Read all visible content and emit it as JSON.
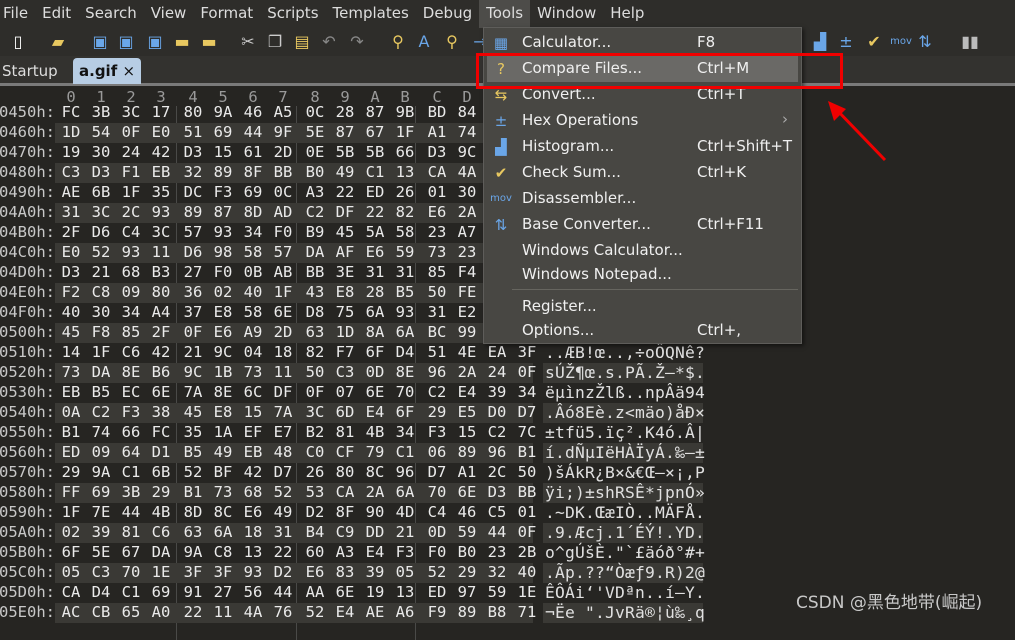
{
  "menubar": [
    "File",
    "Edit",
    "Search",
    "View",
    "Format",
    "Scripts",
    "Templates",
    "Debug",
    "Tools",
    "Window",
    "Help"
  ],
  "active_menu": "Tools",
  "toolbar": [
    {
      "icon": "new-file-icon",
      "glyph": "▯",
      "color": "#ffffff"
    },
    {
      "icon": "open-folder-icon",
      "glyph": "▰",
      "color": "#e8c860"
    },
    {
      "icon": "save-icon",
      "glyph": "▣",
      "color": "#6aa6e8"
    },
    {
      "icon": "save-as-icon",
      "glyph": "▣",
      "color": "#6aa6e8"
    },
    {
      "icon": "save-all-icon",
      "glyph": "▣",
      "color": "#6aa6e8"
    },
    {
      "icon": "folder-icon",
      "glyph": "▬",
      "color": "#e8c860"
    },
    {
      "icon": "folders-icon",
      "glyph": "▬",
      "color": "#e8c860"
    },
    {
      "icon": "cut-icon",
      "glyph": "✂",
      "color": "#cccccc"
    },
    {
      "icon": "copy-icon",
      "glyph": "❐",
      "color": "#cccccc"
    },
    {
      "icon": "paste-icon",
      "glyph": "▤",
      "color": "#e8c860"
    },
    {
      "icon": "undo-icon",
      "glyph": "↶",
      "color": "#888888"
    },
    {
      "icon": "redo-icon",
      "glyph": "↷",
      "color": "#888888"
    },
    {
      "icon": "find-icon",
      "glyph": "⚲",
      "color": "#e8c860"
    },
    {
      "icon": "replace-icon",
      "glyph": "A",
      "color": "#6aa6e8"
    },
    {
      "icon": "find-in-files-icon",
      "glyph": "⚲",
      "color": "#e8c860"
    },
    {
      "icon": "goto-icon",
      "glyph": "→",
      "color": "#6aa6e8"
    },
    {
      "icon": "histogram-icon",
      "glyph": "▟",
      "color": "#6aa6e8"
    },
    {
      "icon": "hex-operations-icon",
      "glyph": "±",
      "color": "#6aa6e8"
    },
    {
      "icon": "checksum-icon",
      "glyph": "✔",
      "color": "#e8c860"
    },
    {
      "icon": "disassembler-icon",
      "glyph": "mov",
      "color": "#6aa6e8"
    },
    {
      "icon": "base-converter-icon",
      "glyph": "⇅",
      "color": "#6aa6e8"
    },
    {
      "icon": "pause-icon",
      "glyph": "▮▮",
      "color": "#bbbbbb"
    }
  ],
  "tabs": [
    {
      "label": "Startup"
    },
    {
      "label": "a.gif",
      "close": "×"
    }
  ],
  "column_headers": [
    "0",
    "1",
    "2",
    "3",
    "4",
    "5",
    "6",
    "7",
    "8",
    "9",
    "A",
    "B",
    "C",
    "D"
  ],
  "rows": [
    {
      "addr": "0450h:",
      "bytes": [
        "FC",
        "3B",
        "3C",
        "17",
        "80",
        "9A",
        "46",
        "A5",
        "0C",
        "28",
        "87",
        "9B",
        "BD",
        "84"
      ],
      "ascii": ""
    },
    {
      "addr": "0460h:",
      "bytes": [
        "1D",
        "54",
        "0F",
        "E0",
        "51",
        "69",
        "44",
        "9F",
        "5E",
        "87",
        "67",
        "1F",
        "A1",
        "74"
      ],
      "ascii": ""
    },
    {
      "addr": "0470h:",
      "bytes": [
        "19",
        "30",
        "24",
        "42",
        "D3",
        "15",
        "61",
        "2D",
        "0E",
        "5B",
        "5B",
        "66",
        "D3",
        "9C"
      ],
      "ascii": ""
    },
    {
      "addr": "0480h:",
      "bytes": [
        "C3",
        "D3",
        "F1",
        "EB",
        "32",
        "89",
        "8F",
        "BB",
        "B0",
        "49",
        "C1",
        "13",
        "CA",
        "4A"
      ],
      "ascii": ""
    },
    {
      "addr": "0490h:",
      "bytes": [
        "AE",
        "6B",
        "1F",
        "35",
        "DC",
        "F3",
        "69",
        "0C",
        "A3",
        "22",
        "ED",
        "26",
        "01",
        "30"
      ],
      "ascii": ""
    },
    {
      "addr": "04A0h:",
      "bytes": [
        "31",
        "3C",
        "2C",
        "93",
        "89",
        "87",
        "8D",
        "AD",
        "C2",
        "DF",
        "22",
        "82",
        "E6",
        "2A"
      ],
      "ascii": ""
    },
    {
      "addr": "04B0h:",
      "bytes": [
        "2F",
        "D6",
        "C4",
        "3C",
        "57",
        "93",
        "34",
        "F0",
        "B9",
        "45",
        "5A",
        "58",
        "23",
        "A7"
      ],
      "ascii": ""
    },
    {
      "addr": "04C0h:",
      "bytes": [
        "E0",
        "52",
        "93",
        "11",
        "D6",
        "98",
        "58",
        "57",
        "DA",
        "AF",
        "E6",
        "59",
        "73",
        "23"
      ],
      "ascii": ""
    },
    {
      "addr": "04D0h:",
      "bytes": [
        "D3",
        "21",
        "68",
        "B3",
        "27",
        "F0",
        "0B",
        "AB",
        "BB",
        "3E",
        "31",
        "31",
        "85",
        "F4"
      ],
      "ascii": ""
    },
    {
      "addr": "04E0h:",
      "bytes": [
        "F2",
        "C8",
        "09",
        "80",
        "36",
        "02",
        "40",
        "1F",
        "43",
        "E8",
        "28",
        "B5",
        "50",
        "FE"
      ],
      "ascii": ""
    },
    {
      "addr": "04F0h:",
      "bytes": [
        "40",
        "30",
        "34",
        "A4",
        "37",
        "E8",
        "58",
        "6E",
        "D8",
        "75",
        "6A",
        "93",
        "31",
        "E2"
      ],
      "ascii": ""
    },
    {
      "addr": "0500h:",
      "bytes": [
        "45",
        "F8",
        "85",
        "2F",
        "0F",
        "E6",
        "A9",
        "2D",
        "63",
        "1D",
        "8A",
        "6A",
        "BC",
        "99"
      ],
      "ascii": ""
    },
    {
      "addr": "0510h:",
      "bytes": [
        "14",
        "1F",
        "C6",
        "42",
        "21",
        "9C",
        "04",
        "18",
        "82",
        "F7",
        "6F",
        "D4",
        "51",
        "4E",
        "EA",
        "3F"
      ],
      "ascii": "..ÆB!œ..‚÷oÔQNê?"
    },
    {
      "addr": "0520h:",
      "bytes": [
        "73",
        "DA",
        "8E",
        "B6",
        "9C",
        "1B",
        "73",
        "11",
        "50",
        "C3",
        "0D",
        "8E",
        "96",
        "2A",
        "24",
        "0F"
      ],
      "ascii": "sÚŽ¶œ.s.PÃ.Ž–*$."
    },
    {
      "addr": "0530h:",
      "bytes": [
        "EB",
        "B5",
        "EC",
        "6E",
        "7A",
        "8E",
        "6C",
        "DF",
        "0F",
        "07",
        "6E",
        "70",
        "C2",
        "E4",
        "39",
        "34"
      ],
      "ascii": "ëµìnzŽlß..npÂä94"
    },
    {
      "addr": "0540h:",
      "bytes": [
        "0A",
        "C2",
        "F3",
        "38",
        "45",
        "E8",
        "15",
        "7A",
        "3C",
        "6D",
        "E4",
        "6F",
        "29",
        "E5",
        "D0",
        "D7"
      ],
      "ascii": ".Âó8Eè.z<mäo)åÐ×"
    },
    {
      "addr": "0550h:",
      "bytes": [
        "B1",
        "74",
        "66",
        "FC",
        "35",
        "1A",
        "EF",
        "E7",
        "B2",
        "81",
        "4B",
        "34",
        "F3",
        "15",
        "C2",
        "7C"
      ],
      "ascii": "±tfü5.ïç².K4ó.Â|"
    },
    {
      "addr": "0560h:",
      "bytes": [
        "ED",
        "09",
        "64",
        "D1",
        "B5",
        "49",
        "EB",
        "48",
        "C0",
        "CF",
        "79",
        "C1",
        "06",
        "89",
        "96",
        "B1"
      ],
      "ascii": "í.dÑµIëHÀÏyÁ.‰–±"
    },
    {
      "addr": "0570h:",
      "bytes": [
        "29",
        "9A",
        "C1",
        "6B",
        "52",
        "BF",
        "42",
        "D7",
        "26",
        "80",
        "8C",
        "96",
        "D7",
        "A1",
        "2C",
        "50"
      ],
      "ascii": ")šÁkR¿B×&€Œ–×¡,P"
    },
    {
      "addr": "0580h:",
      "bytes": [
        "FF",
        "69",
        "3B",
        "29",
        "B1",
        "73",
        "68",
        "52",
        "53",
        "CA",
        "2A",
        "6A",
        "70",
        "6E",
        "D3",
        "BB"
      ],
      "ascii": "ÿi;)±shRSÊ*jpnÓ»"
    },
    {
      "addr": "0590h:",
      "bytes": [
        "1F",
        "7E",
        "44",
        "4B",
        "8D",
        "8C",
        "E6",
        "49",
        "D2",
        "8F",
        "90",
        "4D",
        "C4",
        "46",
        "C5",
        "01"
      ],
      "ascii": ".~DK.ŒæIÒ..MÄFÅ."
    },
    {
      "addr": "05A0h:",
      "bytes": [
        "02",
        "39",
        "81",
        "C6",
        "63",
        "6A",
        "18",
        "31",
        "B4",
        "C9",
        "DD",
        "21",
        "0D",
        "59",
        "44",
        "0F"
      ],
      "ascii": ".9.Æcj.1´ÉÝ!.YD."
    },
    {
      "addr": "05B0h:",
      "bytes": [
        "6F",
        "5E",
        "67",
        "DA",
        "9A",
        "C8",
        "13",
        "22",
        "60",
        "A3",
        "E4",
        "F3",
        "F0",
        "B0",
        "23",
        "2B"
      ],
      "ascii": "o^gÚšÈ.\"`£äóð°#+"
    },
    {
      "addr": "05C0h:",
      "bytes": [
        "05",
        "C3",
        "70",
        "1E",
        "3F",
        "3F",
        "93",
        "D2",
        "E6",
        "83",
        "39",
        "05",
        "52",
        "29",
        "32",
        "40"
      ],
      "ascii": ".Ãp.??“Òæƒ9.R)2@"
    },
    {
      "addr": "05D0h:",
      "bytes": [
        "CA",
        "D4",
        "C1",
        "69",
        "91",
        "27",
        "56",
        "44",
        "AA",
        "6E",
        "19",
        "13",
        "ED",
        "97",
        "59",
        "1E"
      ],
      "ascii": "ÊÔÁi‘'VDªn..í—Y."
    },
    {
      "addr": "05E0h:",
      "bytes": [
        "AC",
        "CB",
        "65",
        "A0",
        "22",
        "11",
        "4A",
        "76",
        "52",
        "E4",
        "AE",
        "A6",
        "F9",
        "89",
        "B8",
        "71"
      ],
      "ascii": "¬Ëe \".JvRä®¦ù‰¸q"
    }
  ],
  "tools_menu": [
    {
      "label": "Calculator...",
      "shortcut": "F8",
      "icon": "calculator-icon",
      "glyph": "▦"
    },
    {
      "label": "Compare Files...",
      "shortcut": "Ctrl+M",
      "icon": "compare-files-icon",
      "glyph": "?",
      "highlighted": true
    },
    {
      "label": "Convert...",
      "shortcut": "Ctrl+T",
      "icon": "convert-icon",
      "glyph": "⇆"
    },
    {
      "label": "Hex Operations",
      "shortcut": "",
      "icon": "hex-operations-icon",
      "glyph": "±",
      "submenu": "›"
    },
    {
      "label": "Histogram...",
      "shortcut": "Ctrl+Shift+T",
      "icon": "histogram-icon",
      "glyph": "▟"
    },
    {
      "label": "Check Sum...",
      "shortcut": "Ctrl+K",
      "icon": "checksum-icon",
      "glyph": "✔"
    },
    {
      "label": "Disassembler...",
      "shortcut": "",
      "icon": "disassembler-icon",
      "glyph": "mov"
    },
    {
      "label": "Base Converter...",
      "shortcut": "Ctrl+F11",
      "icon": "base-converter-icon",
      "glyph": "⇅"
    },
    {
      "label": "Windows Calculator...",
      "shortcut": "",
      "icon": "",
      "glyph": ""
    },
    {
      "label": "Windows Notepad...",
      "shortcut": "",
      "icon": "",
      "glyph": ""
    },
    {
      "label": "Register...",
      "shortcut": "",
      "icon": "",
      "glyph": ""
    },
    {
      "label": "Options...",
      "shortcut": "Ctrl+,",
      "icon": "",
      "glyph": ""
    }
  ],
  "watermark": "CSDN @黑色地带(崛起)",
  "colors": {
    "highlight_box": "#f00000",
    "accent_icon": "#6aa6e8",
    "tab_selected": "#b7cde4"
  }
}
